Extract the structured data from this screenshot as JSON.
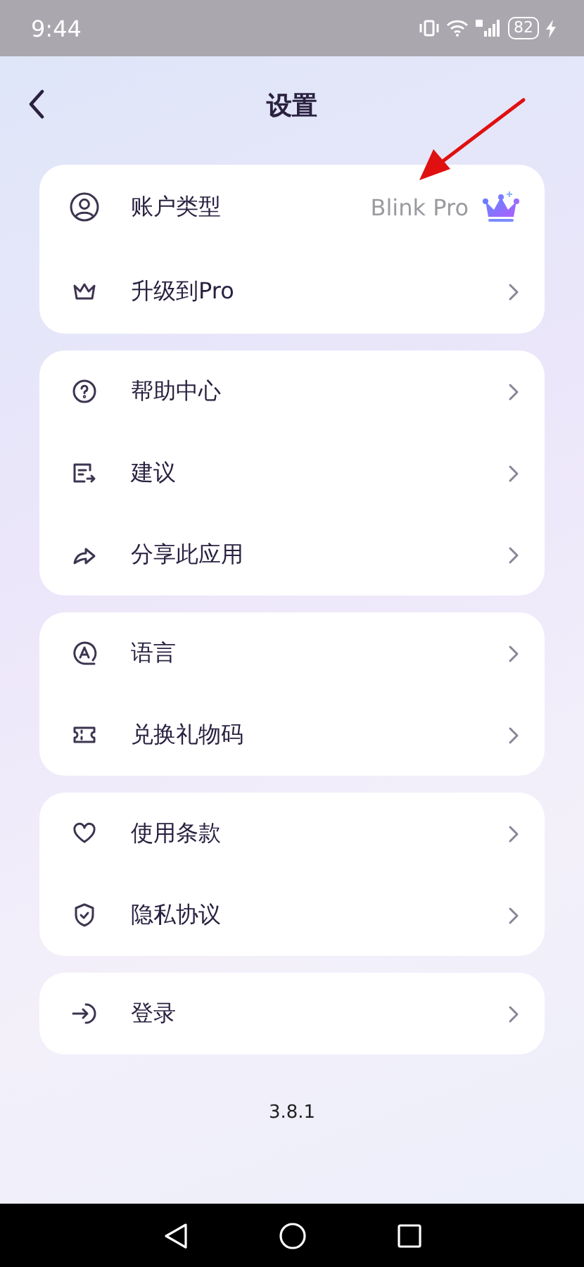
{
  "status_bar": {
    "time": "9:44",
    "battery": "82",
    "charging": true
  },
  "header": {
    "title": "设置"
  },
  "groups": [
    {
      "items": [
        {
          "kind": "value",
          "label": "账户类型",
          "value": "Blink Pro"
        },
        {
          "kind": "link",
          "label": "升级到Pro"
        }
      ]
    },
    {
      "items": [
        {
          "kind": "link",
          "label": "帮助中心"
        },
        {
          "kind": "link",
          "label": "建议"
        },
        {
          "kind": "link",
          "label": "分享此应用"
        }
      ]
    },
    {
      "items": [
        {
          "kind": "link",
          "label": "语言"
        },
        {
          "kind": "link",
          "label": "兑换礼物码"
        }
      ]
    },
    {
      "items": [
        {
          "kind": "link",
          "label": "使用条款"
        },
        {
          "kind": "link",
          "label": "隐私协议"
        }
      ]
    },
    {
      "items": [
        {
          "kind": "link",
          "label": "登录"
        }
      ]
    }
  ],
  "version": "3.8.1",
  "annotation_arrow": true
}
